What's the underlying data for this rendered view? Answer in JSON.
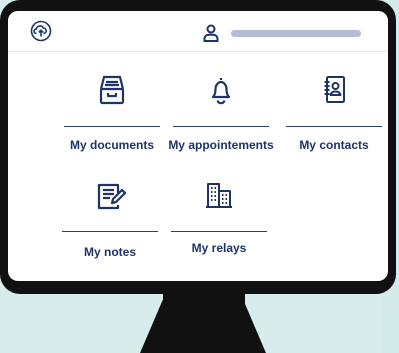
{
  "app": {
    "logo_icon": "cloud-in-circle-logo",
    "user_icon": "user-icon"
  },
  "colors": {
    "primary": "#1f3466",
    "search_bar": "#b5bdd4",
    "background": "#d8ecec",
    "monitor": "#111111"
  },
  "tiles": [
    {
      "label": "My documents",
      "icon": "file-cabinet-icon"
    },
    {
      "label": "My appointements",
      "icon": "bell-icon"
    },
    {
      "label": "My contacts",
      "icon": "address-book-icon"
    },
    {
      "label": "My notes",
      "icon": "note-edit-icon"
    },
    {
      "label": "My relays",
      "icon": "building-icon"
    }
  ]
}
